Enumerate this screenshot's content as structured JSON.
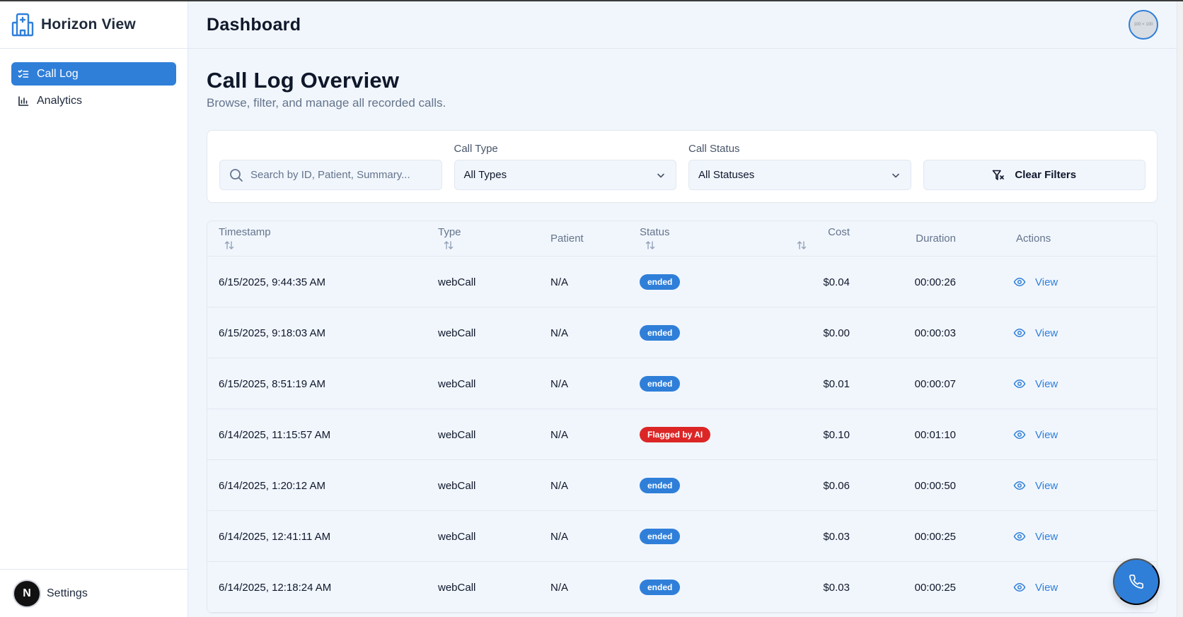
{
  "app": {
    "name": "Horizon View"
  },
  "sidebar": {
    "items": [
      {
        "label": "Call Log",
        "icon": "list-checks-icon",
        "active": true
      },
      {
        "label": "Analytics",
        "icon": "bar-chart-icon",
        "active": false
      }
    ],
    "footer": {
      "avatar_letter": "N",
      "label": "Settings"
    }
  },
  "header": {
    "title": "Dashboard",
    "avatar_text": "100 × 100"
  },
  "page": {
    "title": "Call Log Overview",
    "subtitle": "Browse, filter, and manage all recorded calls."
  },
  "filters": {
    "search_placeholder": "Search by ID, Patient, Summary...",
    "call_type": {
      "label": "Call Type",
      "value": "All Types"
    },
    "call_status": {
      "label": "Call Status",
      "value": "All Statuses"
    },
    "clear_label": "Clear Filters"
  },
  "table": {
    "columns": {
      "timestamp": "Timestamp",
      "type": "Type",
      "patient": "Patient",
      "status": "Status",
      "cost": "Cost",
      "duration": "Duration",
      "actions": "Actions"
    },
    "view_label": "View",
    "rows": [
      {
        "timestamp": "6/15/2025, 9:44:35 AM",
        "type": "webCall",
        "patient": "N/A",
        "status": "ended",
        "cost": "$0.04",
        "duration": "00:00:26"
      },
      {
        "timestamp": "6/15/2025, 9:18:03 AM",
        "type": "webCall",
        "patient": "N/A",
        "status": "ended",
        "cost": "$0.00",
        "duration": "00:00:03"
      },
      {
        "timestamp": "6/15/2025, 8:51:19 AM",
        "type": "webCall",
        "patient": "N/A",
        "status": "ended",
        "cost": "$0.01",
        "duration": "00:00:07"
      },
      {
        "timestamp": "6/14/2025, 11:15:57 AM",
        "type": "webCall",
        "patient": "N/A",
        "status": "Flagged by AI",
        "cost": "$0.10",
        "duration": "00:01:10"
      },
      {
        "timestamp": "6/14/2025, 1:20:12 AM",
        "type": "webCall",
        "patient": "N/A",
        "status": "ended",
        "cost": "$0.06",
        "duration": "00:00:50"
      },
      {
        "timestamp": "6/14/2025, 12:41:11 AM",
        "type": "webCall",
        "patient": "N/A",
        "status": "ended",
        "cost": "$0.03",
        "duration": "00:00:25"
      },
      {
        "timestamp": "6/14/2025, 12:18:24 AM",
        "type": "webCall",
        "patient": "N/A",
        "status": "ended",
        "cost": "$0.03",
        "duration": "00:00:25"
      }
    ]
  },
  "fab": {
    "icon": "phone-icon"
  },
  "colors": {
    "accent": "#2f7fd9",
    "flagged": "#dc2626",
    "background": "#f1f6fd"
  }
}
